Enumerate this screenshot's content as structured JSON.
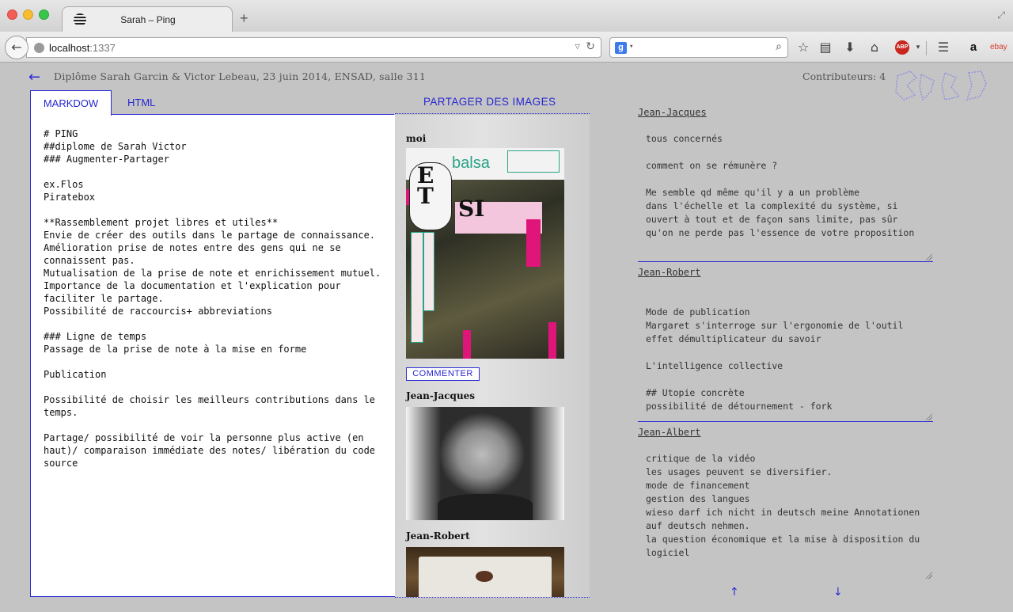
{
  "browser": {
    "tab_title": "Sarah – Ping",
    "new_tab": "+",
    "url_host": "localhost",
    "url_port": ":1337",
    "search_value": ""
  },
  "page": {
    "back_arrow": "←",
    "header": "Diplôme Sarah Garcin & Victor Lebeau, 23 juin 2014, ENSAD, salle 311",
    "contributors": "Contributeurs: 4"
  },
  "editor": {
    "tabs": [
      "MARKDOW",
      "HTML"
    ],
    "content": "# PING\n##diplome de Sarah Victor\n### Augmenter-Partager\n\nex.Flos\nPiratebox\n\n**Rassemblement projet libres et utiles**\nEnvie de créer des outils dans le partage de connaissance.\nAmélioration prise de notes entre des gens qui ne se connaissent pas.\nMutualisation de la prise de note et enrichissement mutuel.\nImportance de la documentation et l'explication pour faciliter le partage.\nPossibilité de raccourcis+ abbreviations\n\n### Ligne de temps\nPassage de la prise de note à la mise en forme\n\nPublication\n\nPossibilité de choisir les meilleurs contributions dans le temps.\n\nPartage/ possibilité de voir la personne plus active (en haut)/ comparaison immédiate des notes/ libération du code source"
  },
  "images": {
    "title": "PARTAGER DES IMAGES",
    "comment_button": "COMMENTER",
    "entries": [
      {
        "author": "moi"
      },
      {
        "author": "Jean-Jacques"
      },
      {
        "author": "Jean-Robert"
      }
    ],
    "poster": {
      "balsa": "balsa",
      "et": "E\nT",
      "si": "SI"
    }
  },
  "comments": [
    {
      "name": "Jean-Jacques",
      "text": "tous concernés\n\ncomment on se rémunère ?\n\nMe semble qd même qu'il y a un problème\ndans l'échelle et la complexité du système, si ouvert à tout et de façon sans limite, pas sûr qu'on ne perde pas l'essence de votre proposition"
    },
    {
      "name": "Jean-Robert",
      "text": "\nMode de publication\nMargaret s'interroge sur l'ergonomie de l'outil\neffet démultiplicateur du savoir\n\nL'intelligence collective\n\n## Utopie concrète\npossibilité de détournement - fork"
    },
    {
      "name": "Jean-Albert",
      "text": "critique de la vidéo\nles usages peuvent se diversifier.\nmode de financement\ngestion des langues\nwieso darf ich nicht in deutsch meine Annotationen auf deutsch nehmen.\nla question économique et la mise à disposition du logiciel"
    }
  ],
  "scroll": {
    "up": "↑",
    "down": "↓"
  },
  "colors": {
    "accent": "#2b2bd6",
    "background": "#c4c4c4"
  }
}
